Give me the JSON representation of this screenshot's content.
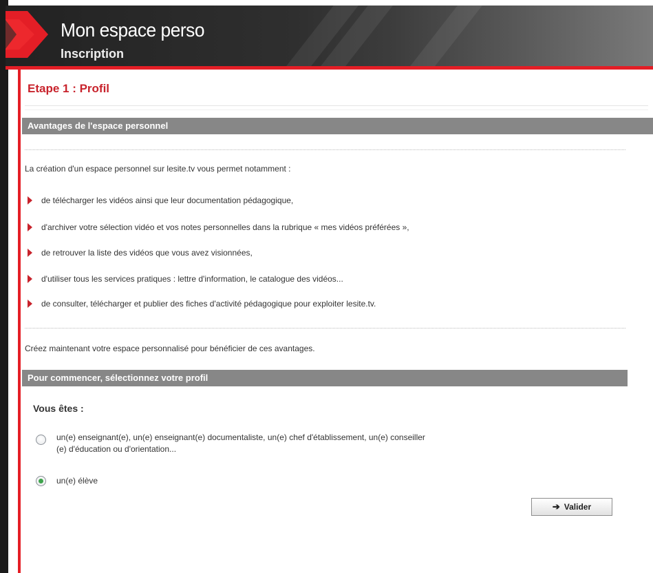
{
  "header": {
    "title": "Mon espace perso",
    "subtitle": "Inscription"
  },
  "step": {
    "title": "Etape 1 : Profil"
  },
  "advantages": {
    "heading": "Avantages de l'espace personnel",
    "intro": "La création d'un espace personnel sur lesite.tv vous permet notamment :",
    "items": [
      "de télécharger les vidéos ainsi que leur documentation pédagogique,",
      "d'archiver votre sélection vidéo et vos notes personnelles dans la rubrique « mes vidéos préférées »,",
      "de retrouver la liste des vidéos que vous avez visionnées,",
      "d'utiliser tous les services pratiques : lettre d'information, le catalogue des vidéos...",
      "de consulter, télécharger et publier des fiches d'activité pédagogique pour exploiter lesite.tv."
    ],
    "outro": "Créez maintenant votre espace personnalisé pour bénéficier de ces avantages."
  },
  "profile": {
    "heading": "Pour commencer, sélectionnez votre profil",
    "question": "Vous êtes :",
    "options": [
      {
        "label_line1": "un(e) enseignant(e), un(e) enseignant(e) documentaliste, un(e) chef d'établissement, un(e) conseiller",
        "label_line2": "(e) d'éducation ou d'orientation...",
        "selected": false
      },
      {
        "label_line1": "un(e) élève",
        "selected": true
      }
    ],
    "submit_label": "Valider"
  },
  "colors": {
    "brand_red": "#e41e26",
    "section_gray": "#878787",
    "title_red": "#c8232c"
  }
}
